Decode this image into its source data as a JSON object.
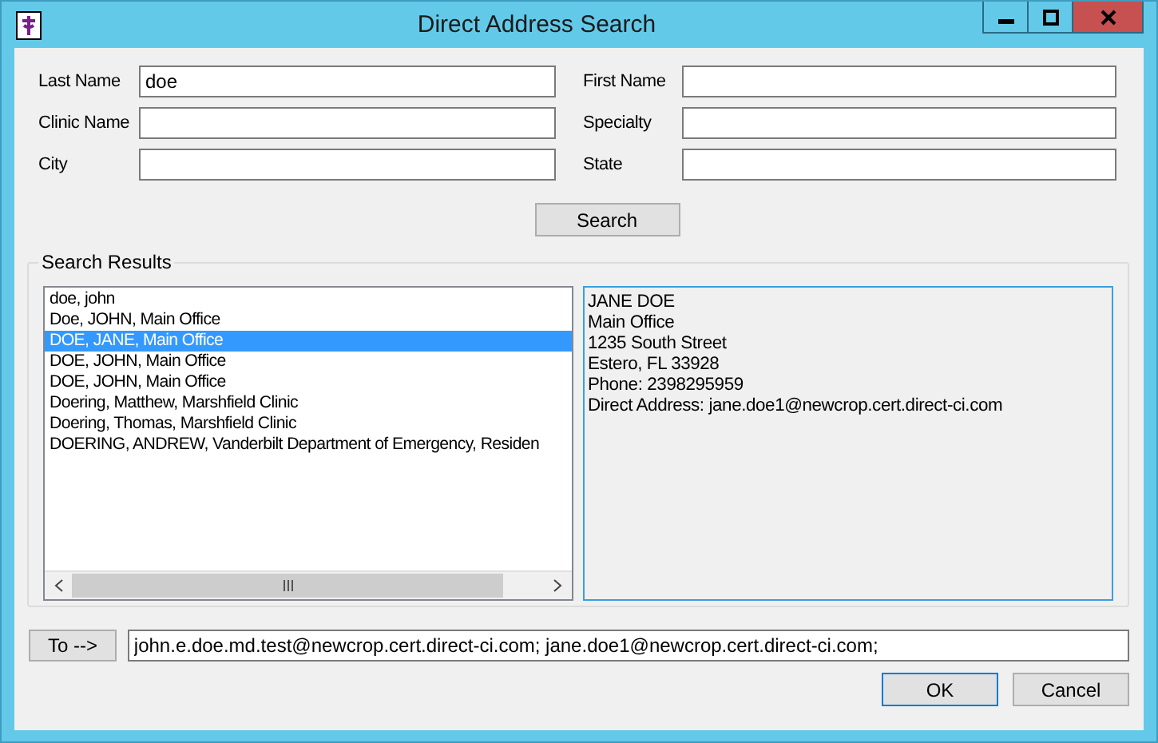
{
  "window": {
    "title": "Direct Address Search"
  },
  "fields": [
    {
      "label": "Last Name",
      "value": "doe"
    },
    {
      "label": "First Name"
    },
    {
      "label": "Clinic Name"
    },
    {
      "label": "Specialty"
    },
    {
      "label": "City"
    },
    {
      "label": "State"
    }
  ],
  "search_button": "Search",
  "results": {
    "title": "Search Results",
    "items": [
      {
        "text": "doe, john",
        "selected": false
      },
      {
        "text": "Doe, JOHN, Main Office",
        "selected": false
      },
      {
        "text": "DOE, JANE, Main Office",
        "selected": true
      },
      {
        "text": "DOE, JOHN, Main Office",
        "selected": false
      },
      {
        "text": "DOE, JOHN, Main Office",
        "selected": false
      },
      {
        "text": "Doering, Matthew, Marshfield Clinic",
        "selected": false
      },
      {
        "text": "Doering, Thomas, Marshfield Clinic",
        "selected": false
      },
      {
        "text": "DOERING, ANDREW, Vanderbilt Department of Emergency, Residen",
        "selected": false
      }
    ],
    "details": [
      "JANE DOE",
      "Main Office",
      "1235 South Street",
      "Estero, FL 33928",
      "Phone: 2398295959",
      "Direct Address: jane.doe1@newcrop.cert.direct-ci.com"
    ]
  },
  "to_button": "To -->",
  "to_value": "john.e.doe.md.test@newcrop.cert.direct-ci.com; jane.doe1@newcrop.cert.direct-ci.com;",
  "buttons": [
    "OK",
    "Cancel"
  ]
}
